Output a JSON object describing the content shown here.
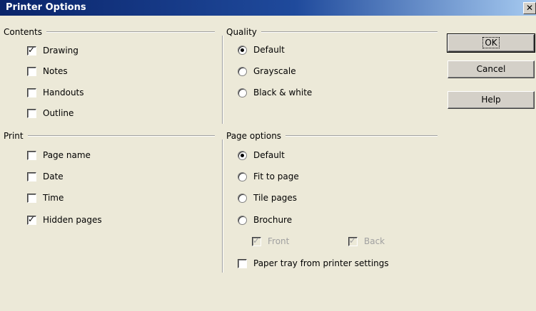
{
  "window": {
    "title": "Printer Options",
    "close_glyph": "✕"
  },
  "contents": {
    "title": "Contents",
    "items": [
      {
        "label": "Drawing",
        "checked": true
      },
      {
        "label": "Notes",
        "checked": false
      },
      {
        "label": "Handouts",
        "checked": false
      },
      {
        "label": "Outline",
        "checked": false
      }
    ]
  },
  "quality": {
    "title": "Quality",
    "options": [
      {
        "label": "Default",
        "selected": true
      },
      {
        "label": "Grayscale",
        "selected": false
      },
      {
        "label": "Black & white",
        "selected": false
      }
    ]
  },
  "print": {
    "title": "Print",
    "items": [
      {
        "label": "Page name",
        "checked": false
      },
      {
        "label": "Date",
        "checked": false
      },
      {
        "label": "Time",
        "checked": false
      },
      {
        "label": "Hidden pages",
        "checked": true
      }
    ]
  },
  "page_options": {
    "title": "Page options",
    "options": [
      {
        "label": "Default",
        "selected": true
      },
      {
        "label": "Fit to page",
        "selected": false
      },
      {
        "label": "Tile pages",
        "selected": false
      },
      {
        "label": "Brochure",
        "selected": false
      }
    ],
    "front": {
      "label": "Front",
      "checked": true,
      "enabled": false
    },
    "back": {
      "label": "Back",
      "checked": true,
      "enabled": false
    },
    "paper_tray": {
      "label": "Paper tray from printer settings",
      "checked": false
    }
  },
  "buttons": {
    "ok": "OK",
    "cancel": "Cancel",
    "help": "Help"
  }
}
